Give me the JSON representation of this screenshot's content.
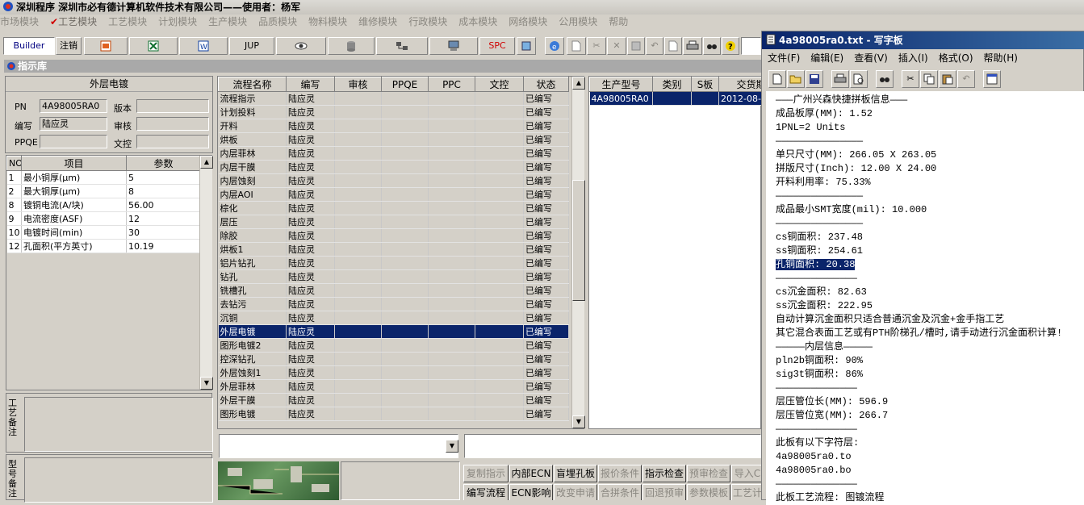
{
  "app": {
    "title": "深圳程序    深圳市必有德计算机软件技术有限公司——使用者：杨军",
    "menu": [
      "市场模块",
      "工艺模块",
      "工艺模块",
      "计划模块",
      "生产模块",
      "品质模块",
      "物料模块",
      "维修模块",
      "行政模块",
      "成本模块",
      "网络模块",
      "公用模块",
      "帮助"
    ],
    "menu_checked_index": 1
  },
  "toolbar": {
    "builder": "Builder",
    "logout": "注销",
    "jup": "JUP",
    "spc": "SPC"
  },
  "panel": {
    "title": "指示库",
    "step_title": "外层电镀",
    "pn_label": "PN",
    "pn_value": "4A98005RA0",
    "version_label": "版本",
    "author_label": "编写",
    "author_value": "陆应灵",
    "review_label": "审核",
    "ppqe_label": "PPQE",
    "doc_label": "文控",
    "process_note_label": "工艺备注",
    "model_note_label": "型号备注"
  },
  "params": {
    "headers": [
      "NO",
      "项目",
      "参数"
    ],
    "rows": [
      [
        "1",
        "最小铜厚(μm)",
        "5"
      ],
      [
        "2",
        "最大铜厚(μm)",
        "8"
      ],
      [
        "8",
        "镀铜电流(A/块)",
        "56.00"
      ],
      [
        "9",
        "电流密度(ASF)",
        "12"
      ],
      [
        "10",
        "电镀时间(min)",
        "30"
      ],
      [
        "12",
        "孔面积(平方英寸)",
        "10.19"
      ]
    ]
  },
  "flow": {
    "headers": [
      "流程名称",
      "编写",
      "审核",
      "PPQE",
      "PPC",
      "文控",
      "状态"
    ],
    "selected_index": 17,
    "rows": [
      [
        "流程指示",
        "陆应灵",
        "",
        "",
        "",
        "",
        "已编写"
      ],
      [
        "计划投料",
        "陆应灵",
        "",
        "",
        "",
        "",
        "已编写"
      ],
      [
        "开料",
        "陆应灵",
        "",
        "",
        "",
        "",
        "已编写"
      ],
      [
        "烘板",
        "陆应灵",
        "",
        "",
        "",
        "",
        "已编写"
      ],
      [
        "内层菲林",
        "陆应灵",
        "",
        "",
        "",
        "",
        "已编写"
      ],
      [
        "内层干膜",
        "陆应灵",
        "",
        "",
        "",
        "",
        "已编写"
      ],
      [
        "内层蚀刻",
        "陆应灵",
        "",
        "",
        "",
        "",
        "已编写"
      ],
      [
        "内层AOI",
        "陆应灵",
        "",
        "",
        "",
        "",
        "已编写"
      ],
      [
        "棕化",
        "陆应灵",
        "",
        "",
        "",
        "",
        "已编写"
      ],
      [
        "层压",
        "陆应灵",
        "",
        "",
        "",
        "",
        "已编写"
      ],
      [
        "除胶",
        "陆应灵",
        "",
        "",
        "",
        "",
        "已编写"
      ],
      [
        "烘板1",
        "陆应灵",
        "",
        "",
        "",
        "",
        "已编写"
      ],
      [
        "铝片钻孔",
        "陆应灵",
        "",
        "",
        "",
        "",
        "已编写"
      ],
      [
        "钻孔",
        "陆应灵",
        "",
        "",
        "",
        "",
        "已编写"
      ],
      [
        "铣槽孔",
        "陆应灵",
        "",
        "",
        "",
        "",
        "已编写"
      ],
      [
        "去钻污",
        "陆应灵",
        "",
        "",
        "",
        "",
        "已编写"
      ],
      [
        "沉铜",
        "陆应灵",
        "",
        "",
        "",
        "",
        "已编写"
      ],
      [
        "外层电镀",
        "陆应灵",
        "",
        "",
        "",
        "",
        "已编写"
      ],
      [
        "图形电镀2",
        "陆应灵",
        "",
        "",
        "",
        "",
        "已编写"
      ],
      [
        "控深钻孔",
        "陆应灵",
        "",
        "",
        "",
        "",
        "已编写"
      ],
      [
        "外层蚀刻1",
        "陆应灵",
        "",
        "",
        "",
        "",
        "已编写"
      ],
      [
        "外层菲林",
        "陆应灵",
        "",
        "",
        "",
        "",
        "已编写"
      ],
      [
        "外层干膜",
        "陆应灵",
        "",
        "",
        "",
        "",
        "已编写"
      ],
      [
        "图形电镀",
        "陆应灵",
        "",
        "",
        "",
        "",
        "已编写"
      ]
    ]
  },
  "orders": {
    "headers": [
      "生产型号",
      "类别",
      "S板",
      "交货期"
    ],
    "rows": [
      [
        "4A98005RA0",
        "",
        "",
        "2012-08-"
      ]
    ]
  },
  "buttons": {
    "row1": [
      "复制指示",
      "内部ECN",
      "盲埋孔板",
      "报价条件",
      "指示检查",
      "预审检查",
      "导入C"
    ],
    "row1_enabled": [
      false,
      true,
      true,
      false,
      true,
      false,
      false
    ],
    "row2": [
      "编写流程",
      "ECN影响",
      "改变申请",
      "合拼条件",
      "回退预审",
      "参数模板",
      "工艺计"
    ],
    "row2_enabled": [
      true,
      true,
      false,
      false,
      false,
      false,
      false
    ]
  },
  "notepad": {
    "title": "4a98005ra0.txt - 写字板",
    "menu": [
      "文件(F)",
      "编辑(E)",
      "查看(V)",
      "插入(I)",
      "格式(O)",
      "帮助(H)"
    ],
    "lines": [
      "———广州兴森快捷拼板信息———",
      "成品板厚(MM): 1.52",
      "1PNL=2 Units",
      "———————————————",
      "单只尺寸(MM): 266.05 X 263.05",
      "拼版尺寸(Inch): 12.00 X 24.00",
      "开料利用率: 75.33%",
      "———————————————",
      "成品最小SMT宽度(mil): 10.000",
      "———————————————",
      "cs铜面积: 237.48",
      "ss铜面积: 254.61",
      "孔铜面积: 20.38",
      "——————————————",
      "cs沉金面积: 82.63",
      "ss沉金面积: 222.95",
      "自动计算沉金面积只适合普通沉金及沉金+金手指工艺",
      "其它混合表面工艺或有PTH阶梯孔/槽时,请手动进行沉金面积计算!",
      "—————内层信息—————",
      "pln2b铜面积: 90%",
      "sig3t铜面积: 86%",
      "——————————————",
      "层压管位长(MM): 596.9",
      "层压管位宽(MM): 266.7",
      "——————————————",
      "此板有以下字符层:",
      "4a98005ra0.to",
      "4a98005ra0.bo",
      "——————————————",
      "此板工艺流程: 图镀流程"
    ],
    "highlight_line": 12
  }
}
